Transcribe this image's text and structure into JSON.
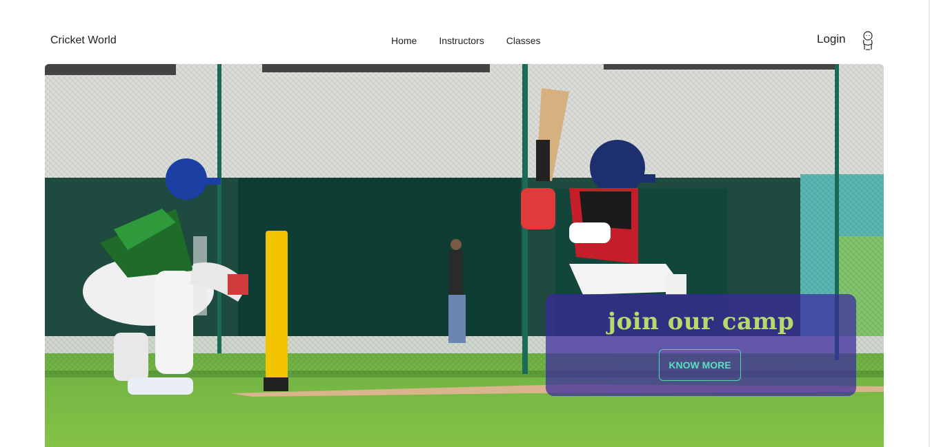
{
  "header": {
    "brand": "Cricket World",
    "nav": [
      {
        "label": "Home"
      },
      {
        "label": "Instructors"
      },
      {
        "label": "Classes"
      }
    ],
    "login_label": "Login",
    "user_icon": "user-avatar-icon"
  },
  "hero": {
    "image_subject": "youth cricket match photo",
    "cta": {
      "title": "join our camp",
      "button_label": "KNOW MORE",
      "card_color": "#3c28a0",
      "title_color": "#b7d96d",
      "button_color": "#59e0c0"
    }
  }
}
